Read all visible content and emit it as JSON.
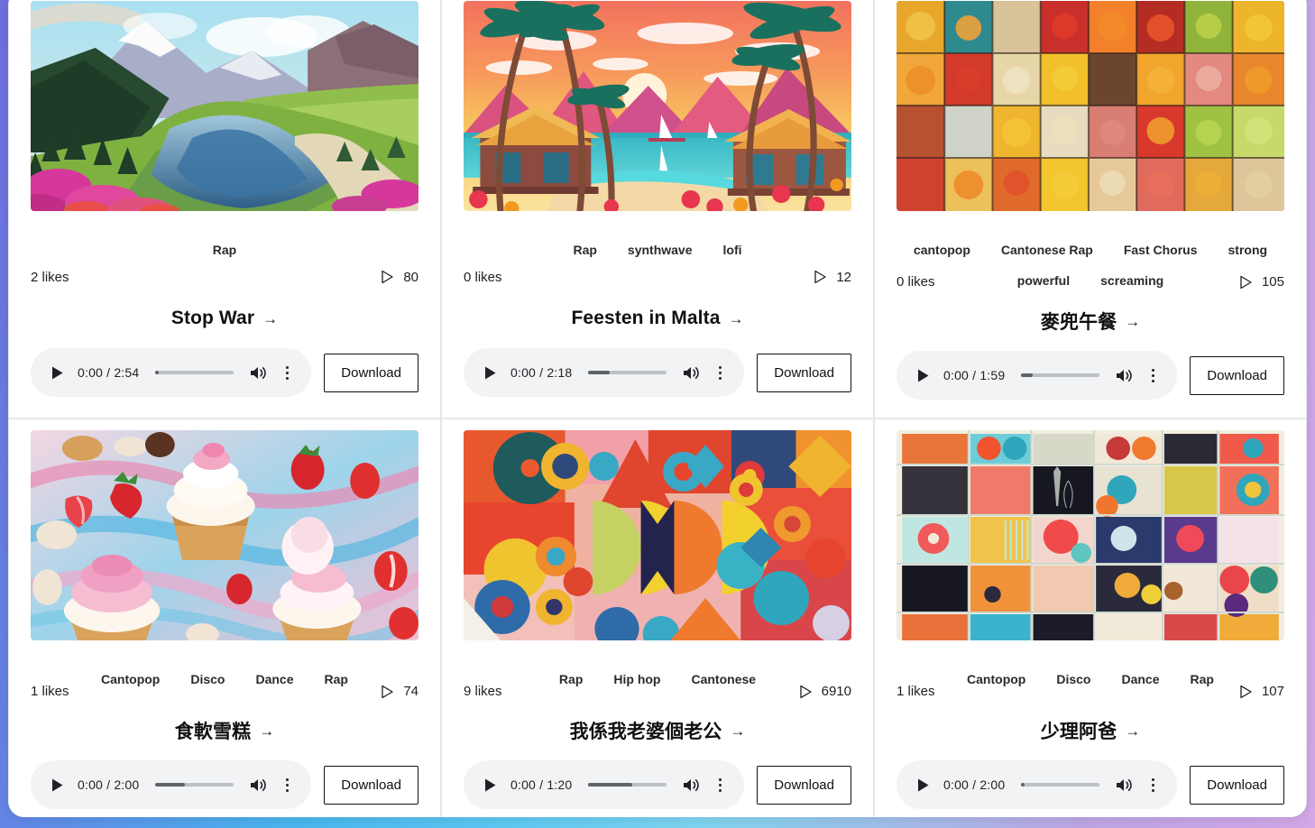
{
  "theme": {
    "page_bg_gradient_from": "#6f6fe0",
    "page_bg_gradient_mid": "#5ec9f2",
    "page_bg_gradient_to": "#d3a7e8",
    "card_bg": "#ffffff",
    "card_border": "#e7e7e9",
    "player_bg": "#f1f3f4",
    "text_primary": "#111114"
  },
  "labels": {
    "download": "Download",
    "arrow": "→",
    "likes_suffix": "likes"
  },
  "cards": [
    {
      "id": "stop-war",
      "cover": "mountain-valley-lake-landscape",
      "tags": [
        "Rap"
      ],
      "likes": "2 likes",
      "plays": "80",
      "title": "Stop War",
      "arrow": "→",
      "player": {
        "time": "0:00 / 2:54",
        "progress_pct": 4,
        "duration": "2:54",
        "current": "0:00"
      },
      "download_label": "Download"
    },
    {
      "id": "feesten-in-malta",
      "cover": "tropical-sunset-beach-palms",
      "tags": [
        "Rap",
        "synthwave",
        "lofi"
      ],
      "likes": "0 likes",
      "plays": "12",
      "title": "Feesten in Malta",
      "arrow": "→",
      "player": {
        "time": "0:00 / 2:18",
        "progress_pct": 27,
        "duration": "2:18",
        "current": "0:00"
      },
      "download_label": "Download"
    },
    {
      "id": "mak-dau-lunch",
      "cover": "food-collage-grid",
      "tags": [
        "cantopop",
        "Cantonese Rap",
        "Fast Chorus",
        "strong",
        "powerful",
        "screaming"
      ],
      "likes": "0 likes",
      "plays": "105",
      "title": "麥兜午餐",
      "arrow": "→",
      "player": {
        "time": "0:00 / 1:59",
        "progress_pct": 14,
        "duration": "1:59",
        "current": "0:00"
      },
      "download_label": "Download"
    },
    {
      "id": "soft-ice-cream",
      "cover": "cupcakes-strawberries-dessert",
      "tags": [
        "Cantopop",
        "Disco",
        "Dance",
        "Rap"
      ],
      "likes": "1 likes",
      "plays": "74",
      "title": "食軟雪糕",
      "arrow": "→",
      "player": {
        "time": "0:00 / 2:00",
        "progress_pct": 38,
        "duration": "2:00",
        "current": "0:00"
      },
      "download_label": "Download"
    },
    {
      "id": "i-am-my-wifes-husband",
      "cover": "abstract-geometric-shapes",
      "tags": [
        "Rap",
        "Hip hop",
        "Cantonese"
      ],
      "likes": "9 likes",
      "plays": "6910",
      "title": "我係我老婆個老公",
      "arrow": "→",
      "player": {
        "time": "0:00 / 1:20",
        "progress_pct": 56,
        "duration": "1:20",
        "current": "0:00"
      },
      "download_label": "Download"
    },
    {
      "id": "ignore-dad",
      "cover": "patchwork-quilt-print-collage",
      "tags": [
        "Cantopop",
        "Disco",
        "Dance",
        "Rap"
      ],
      "likes": "1 likes",
      "plays": "107",
      "title": "少理阿爸",
      "arrow": "→",
      "player": {
        "time": "0:00 / 2:00",
        "progress_pct": 4,
        "duration": "2:00",
        "current": "0:00"
      },
      "download_label": "Download"
    }
  ]
}
